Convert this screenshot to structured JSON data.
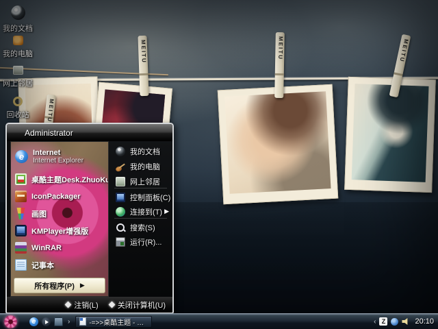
{
  "desktop": {
    "clothespin_text": "MEITU",
    "icons": [
      {
        "name": "my-documents",
        "label": "我的文档"
      },
      {
        "name": "my-computer",
        "label": "我的电脑"
      },
      {
        "name": "network-places",
        "label": "网上邻居"
      },
      {
        "name": "recycle-bin",
        "label": "回收站"
      }
    ]
  },
  "start_menu": {
    "user_name": "Administrator",
    "left_items": [
      {
        "name": "internet-explorer",
        "label": "Internet",
        "sublabel": "Internet Explorer"
      },
      {
        "name": "zhuoku-theme",
        "label": "桌酷主题Desk.ZhuoKu.Com"
      },
      {
        "name": "iconpackager",
        "label": "IconPackager"
      },
      {
        "name": "paint",
        "label": "画图"
      },
      {
        "name": "kmplayer",
        "label": "KMPlayer增强版"
      },
      {
        "name": "winrar",
        "label": "WinRAR"
      },
      {
        "name": "notepad",
        "label": "记事本"
      }
    ],
    "all_programs_label": "所有程序(P)",
    "right_items": [
      {
        "name": "my-documents",
        "label": "我的文档"
      },
      {
        "name": "my-computer",
        "label": "我的电脑"
      },
      {
        "name": "network-places",
        "label": "网上邻居"
      },
      {
        "name": "control-panel",
        "label": "控制面板(C)"
      },
      {
        "name": "connect-to",
        "label": "连接到(T)"
      },
      {
        "name": "search",
        "label": "搜索(S)"
      },
      {
        "name": "run",
        "label": "运行(R)..."
      }
    ],
    "logoff_label": "注销(L)",
    "shutdown_label": "关闭计算机(U)"
  },
  "taskbar": {
    "task_button_label": "-=>>桌酷主题 - Mic...",
    "clock": "20:10"
  },
  "icons": {
    "submenu_arrow": "▶",
    "all_programs_arrow": "▶",
    "quick_launch_chevron": "›",
    "tray_chevron": "‹"
  },
  "colors": {
    "wall_base": "#243240",
    "taskbar_dark": "#0e1620",
    "flower_pink": "#e0559a",
    "rope": "#e6dfcd",
    "all_programs_bg": "#f5efd6"
  }
}
